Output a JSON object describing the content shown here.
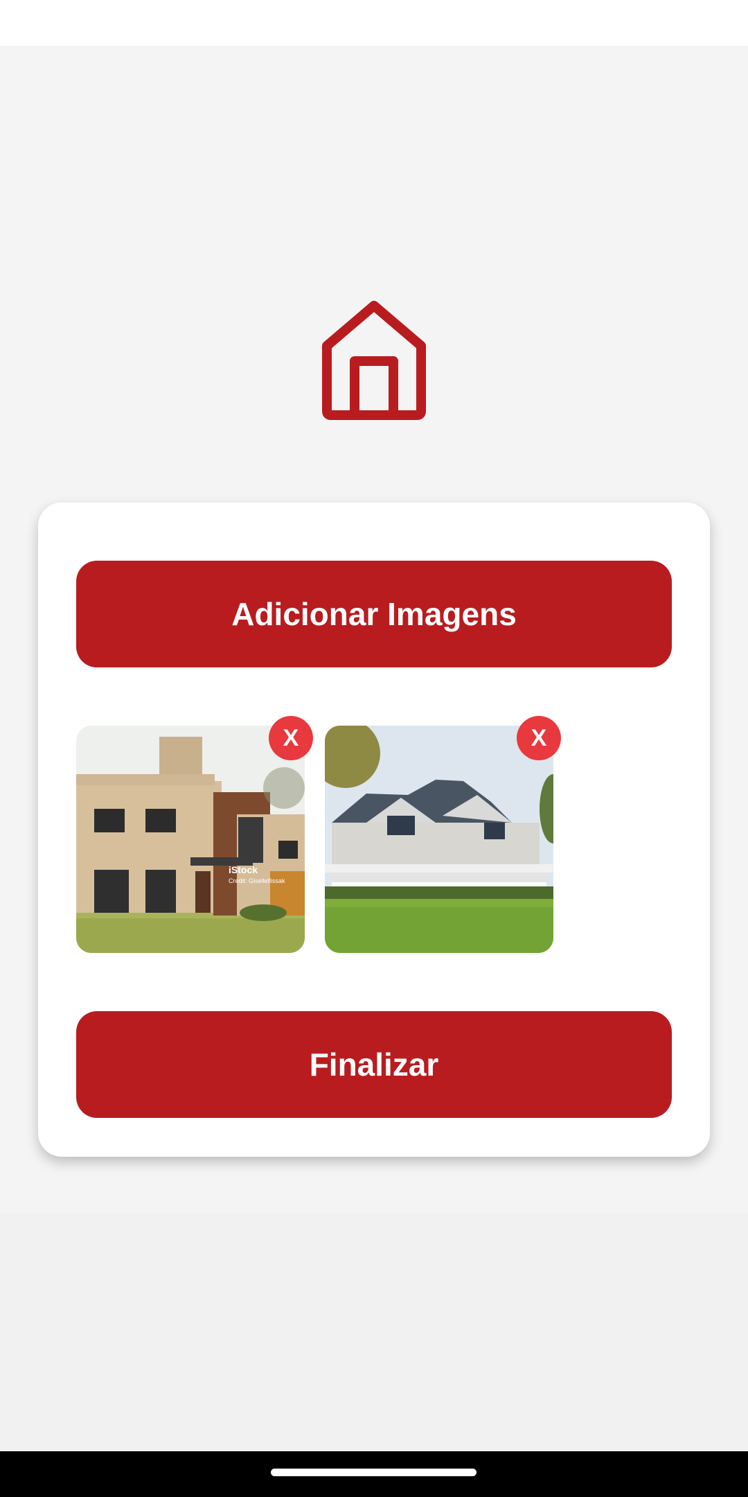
{
  "icons": {
    "logo": "house-icon",
    "remove": "close-icon"
  },
  "colors": {
    "accent": "#b91c1f",
    "remove": "#e8393f",
    "background": "#f4f4f4",
    "card": "#ffffff"
  },
  "actions": {
    "add_images_label": "Adicionar Imagens",
    "finish_label": "Finalizar"
  },
  "gallery": {
    "images": [
      {
        "remove_label": "X",
        "watermark_brand": "iStock",
        "watermark_credit": "Credit: Giselleflissak"
      },
      {
        "remove_label": "X"
      }
    ]
  }
}
